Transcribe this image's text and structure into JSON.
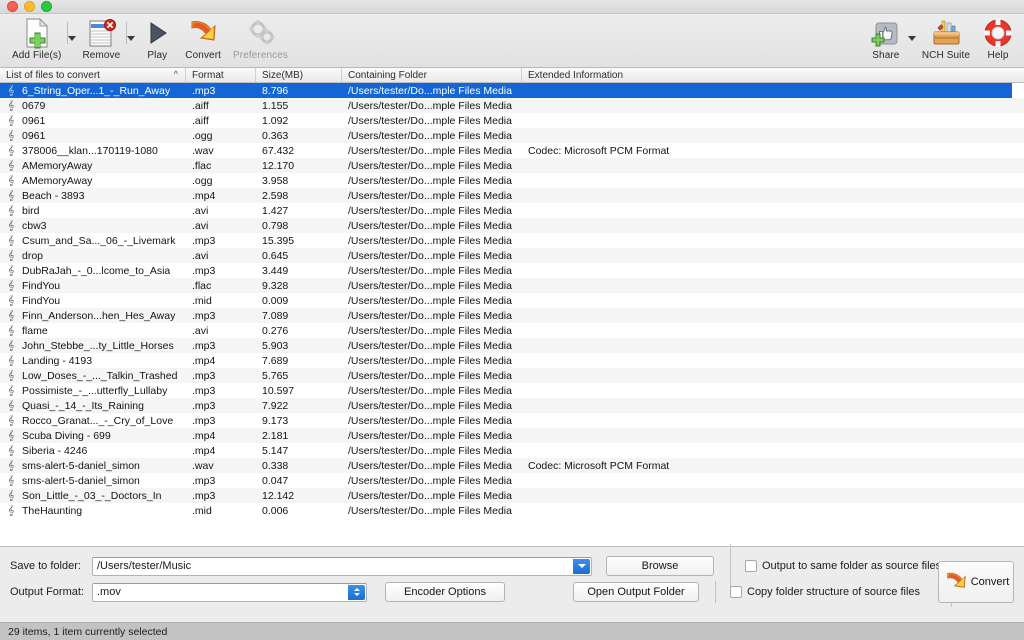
{
  "window": {
    "traffic_lights": [
      "close",
      "minimize",
      "maximize"
    ]
  },
  "toolbar": {
    "left_items": [
      {
        "label": "Add File(s)",
        "icon": "add-file-icon",
        "has_dropdown": true,
        "disabled": false
      },
      {
        "label": "Remove",
        "icon": "remove-file-icon",
        "has_dropdown": true,
        "disabled": false
      },
      {
        "label": "Play",
        "icon": "play-icon",
        "has_dropdown": false,
        "disabled": false
      },
      {
        "label": "Convert",
        "icon": "convert-icon",
        "has_dropdown": false,
        "disabled": false
      },
      {
        "label": "Preferences",
        "icon": "preferences-gears-icon",
        "has_dropdown": false,
        "disabled": true
      }
    ],
    "right_items": [
      {
        "label": "Share",
        "icon": "share-thumbsup-icon",
        "has_dropdown": true
      },
      {
        "label": "NCH Suite",
        "icon": "nch-suite-toolbox-icon",
        "has_dropdown": false
      },
      {
        "label": "Help",
        "icon": "help-lifering-icon",
        "has_dropdown": false
      }
    ]
  },
  "file_list": {
    "columns": [
      {
        "key": "name",
        "label": "List of files to convert",
        "sorted": true,
        "sort_arrow": "^"
      },
      {
        "key": "format",
        "label": "Format"
      },
      {
        "key": "size",
        "label": "Size(MB)"
      },
      {
        "key": "folder",
        "label": "Containing Folder"
      },
      {
        "key": "extended",
        "label": "Extended Information"
      }
    ],
    "folder_default": "/Users/tester/Do...mple Files Media",
    "rows": [
      {
        "name": "6_String_Oper...1_-_Run_Away",
        "format": ".mp3",
        "size": "8.796",
        "folder": "/Users/tester/Do...mple Files Media",
        "extended": "",
        "selected": true
      },
      {
        "name": "0679",
        "format": ".aiff",
        "size": "1.155",
        "folder": "/Users/tester/Do...mple Files Media",
        "extended": "",
        "selected": false
      },
      {
        "name": "0961",
        "format": ".aiff",
        "size": "1.092",
        "folder": "/Users/tester/Do...mple Files Media",
        "extended": "",
        "selected": false
      },
      {
        "name": "0961",
        "format": ".ogg",
        "size": "0.363",
        "folder": "/Users/tester/Do...mple Files Media",
        "extended": "",
        "selected": false
      },
      {
        "name": "378006__klan...170119-1080",
        "format": ".wav",
        "size": "67.432",
        "folder": "/Users/tester/Do...mple Files Media",
        "extended": "Codec: Microsoft PCM Format",
        "selected": false
      },
      {
        "name": "AMemoryAway",
        "format": ".flac",
        "size": "12.170",
        "folder": "/Users/tester/Do...mple Files Media",
        "extended": "",
        "selected": false
      },
      {
        "name": "AMemoryAway",
        "format": ".ogg",
        "size": "3.958",
        "folder": "/Users/tester/Do...mple Files Media",
        "extended": "",
        "selected": false
      },
      {
        "name": "Beach - 3893",
        "format": ".mp4",
        "size": "2.598",
        "folder": "/Users/tester/Do...mple Files Media",
        "extended": "",
        "selected": false
      },
      {
        "name": "bird",
        "format": ".avi",
        "size": "1.427",
        "folder": "/Users/tester/Do...mple Files Media",
        "extended": "",
        "selected": false
      },
      {
        "name": "cbw3",
        "format": ".avi",
        "size": "0.798",
        "folder": "/Users/tester/Do...mple Files Media",
        "extended": "",
        "selected": false
      },
      {
        "name": "Csum_and_Sa..._06_-_Livemark",
        "format": ".mp3",
        "size": "15.395",
        "folder": "/Users/tester/Do...mple Files Media",
        "extended": "",
        "selected": false
      },
      {
        "name": "drop",
        "format": ".avi",
        "size": "0.645",
        "folder": "/Users/tester/Do...mple Files Media",
        "extended": "",
        "selected": false
      },
      {
        "name": "DubRaJah_-_0...lcome_to_Asia",
        "format": ".mp3",
        "size": "3.449",
        "folder": "/Users/tester/Do...mple Files Media",
        "extended": "",
        "selected": false
      },
      {
        "name": "FindYou",
        "format": ".flac",
        "size": "9.328",
        "folder": "/Users/tester/Do...mple Files Media",
        "extended": "",
        "selected": false
      },
      {
        "name": "FindYou",
        "format": ".mid",
        "size": "0.009",
        "folder": "/Users/tester/Do...mple Files Media",
        "extended": "",
        "selected": false
      },
      {
        "name": "Finn_Anderson...hen_Hes_Away",
        "format": ".mp3",
        "size": "7.089",
        "folder": "/Users/tester/Do...mple Files Media",
        "extended": "",
        "selected": false
      },
      {
        "name": "flame",
        "format": ".avi",
        "size": "0.276",
        "folder": "/Users/tester/Do...mple Files Media",
        "extended": "",
        "selected": false
      },
      {
        "name": "John_Stebbe_...ty_Little_Horses",
        "format": ".mp3",
        "size": "5.903",
        "folder": "/Users/tester/Do...mple Files Media",
        "extended": "",
        "selected": false
      },
      {
        "name": "Landing - 4193",
        "format": ".mp4",
        "size": "7.689",
        "folder": "/Users/tester/Do...mple Files Media",
        "extended": "",
        "selected": false
      },
      {
        "name": "Low_Doses_-_..._Talkin_Trashed",
        "format": ".mp3",
        "size": "5.765",
        "folder": "/Users/tester/Do...mple Files Media",
        "extended": "",
        "selected": false
      },
      {
        "name": "Possimiste_-_...utterfly_Lullaby",
        "format": ".mp3",
        "size": "10.597",
        "folder": "/Users/tester/Do...mple Files Media",
        "extended": "",
        "selected": false
      },
      {
        "name": "Quasi_-_14_-_Its_Raining",
        "format": ".mp3",
        "size": "7.922",
        "folder": "/Users/tester/Do...mple Files Media",
        "extended": "",
        "selected": false
      },
      {
        "name": "Rocco_Granat..._-_Cry_of_Love",
        "format": ".mp3",
        "size": "9.173",
        "folder": "/Users/tester/Do...mple Files Media",
        "extended": "",
        "selected": false
      },
      {
        "name": "Scuba Diving - 699",
        "format": ".mp4",
        "size": "2.181",
        "folder": "/Users/tester/Do...mple Files Media",
        "extended": "",
        "selected": false
      },
      {
        "name": "Siberia - 4246",
        "format": ".mp4",
        "size": "5.147",
        "folder": "/Users/tester/Do...mple Files Media",
        "extended": "",
        "selected": false
      },
      {
        "name": "sms-alert-5-daniel_simon",
        "format": ".wav",
        "size": "0.338",
        "folder": "/Users/tester/Do...mple Files Media",
        "extended": "Codec: Microsoft PCM Format",
        "selected": false
      },
      {
        "name": "sms-alert-5-daniel_simon",
        "format": ".mp3",
        "size": "0.047",
        "folder": "/Users/tester/Do...mple Files Media",
        "extended": "",
        "selected": false
      },
      {
        "name": "Son_Little_-_03_-_Doctors_In",
        "format": ".mp3",
        "size": "12.142",
        "folder": "/Users/tester/Do...mple Files Media",
        "extended": "",
        "selected": false
      },
      {
        "name": "TheHaunting",
        "format": ".mid",
        "size": "0.006",
        "folder": "/Users/tester/Do...mple Files Media",
        "extended": "",
        "selected": false
      }
    ]
  },
  "bottom_panel": {
    "save_to_folder_label": "Save to folder:",
    "save_to_folder_value": "/Users/tester/Music",
    "output_format_label": "Output Format:",
    "output_format_value": ".mov",
    "browse_button": "Browse",
    "encoder_options_button": "Encoder Options",
    "open_output_folder_button": "Open Output Folder",
    "checkbox_same_folder": {
      "label": "Output to same folder as source files",
      "checked": false
    },
    "checkbox_copy_structure": {
      "label": "Copy folder structure of source files",
      "checked": false
    },
    "convert_button": "Convert"
  },
  "status_bar": {
    "text": "29 items, 1 item currently selected"
  },
  "colors": {
    "selection_blue": "#1466d6",
    "toolbar_bg": "#ededed",
    "status_bg": "#c3c3c3",
    "accent_orange": "#f08030"
  }
}
